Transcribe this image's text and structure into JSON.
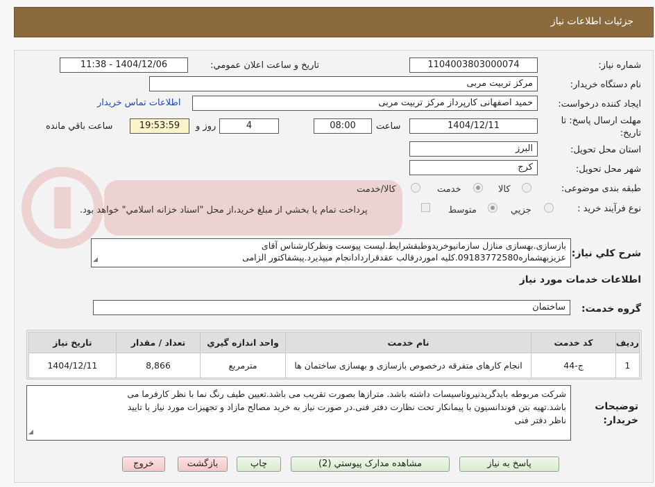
{
  "header": {
    "title": "جزئیات اطلاعات نیاز"
  },
  "fields": {
    "need_number_label": "شماره نیاز:",
    "need_number": "1104003803000074",
    "announce_label": "تاریخ و ساعت اعلان عمومي:",
    "announce_value": "1404/12/06 - 11:38",
    "buyer_org_label": "نام دستگاه خريدار:",
    "buyer_org": "مرکز تربیت مربی",
    "creator_label": "ايجاد کننده درخواست:",
    "creator": "حمید اصفهانی کارپرداز مرکز تربیت مربی",
    "contact_link": "اطلاعات تماس خريدار",
    "deadline_label": "مهلت ارسال پاسخ: تا تاریخ:",
    "deadline_date": "1404/12/11",
    "time_label": "ساعت",
    "deadline_time": "08:00",
    "days": "4",
    "days_label": "روز و",
    "remaining_time": "19:53:59",
    "remaining_label": "ساعت باقي مانده",
    "province_label": "استان محل تحویل:",
    "province": "البرز",
    "city_label": "شهر محل تحویل:",
    "city": "کرج",
    "category_label": "طبقه بندی موضوعی:",
    "category_options": [
      "کالا",
      "خدمت",
      "کالا/خدمت"
    ],
    "category_selected": "خدمت",
    "process_label": "نوع فرآیند خرید :",
    "process_options": [
      "جزيي",
      "متوسط"
    ],
    "process_selected": "متوسط",
    "payment_note": "پرداخت تمام يا بخشي از مبلغ خريد،از محل \"اسناد خزانه اسلامي\" خواهد بود."
  },
  "description": {
    "label": "شرح کلي نياز:",
    "line1": "بازسازی.بهسازی منازل سازمانیوخریدوطبقشرایط.لیست پیوست ونظرکارشناس آقای",
    "line2": "عزیزبهشماره09183772580.کلیه اموردرقالب عقدقراردادانجام میپذیرد.پیشفاکتور الزامی"
  },
  "services": {
    "section_title": "اطلاعات خدمات مورد نياز",
    "group_label": "گروه خدمت:",
    "group_value": "ساختمان",
    "columns": [
      "رديف",
      "کد خدمت",
      "نام خدمت",
      "واحد اندازه گيري",
      "تعداد / مقدار",
      "تاريخ نياز"
    ],
    "rows": [
      [
        "1",
        "ج-44",
        "انجام کارهای متفرقه درخصوص بازسازی و بهسازی ساختمان ها",
        "مترمربع",
        "8,866",
        "1404/12/11"
      ]
    ]
  },
  "buyer_notes": {
    "label": "توضيحات خريدار:",
    "line1": "شرکت مربوطه بایدگریدنیروتاسیسات داشته باشد. مترازها بصورت تقریب می باشد.تعیین طیف  رنگ نما با نظر کارفرما می",
    "line2": "باشد.تهیه بتن فوندانسیون با پیمانکار تحت نظارت دفتر فنی.در صورت نیاز به خرید مصالح  مازاد و تجهیزات مورد نیاز با تایید",
    "line3": "ناظر دفتر فنی"
  },
  "buttons": {
    "reply": "پاسخ به نياز",
    "attachments": "مشاهده مدارک پيوستي (2)",
    "print": "چاپ",
    "back": "بازگشت",
    "exit": "خروج"
  },
  "colors": {
    "header_bg": "#8b6b3d",
    "link": "#1a46c8",
    "remaining_bg": "#fbf4c8"
  }
}
